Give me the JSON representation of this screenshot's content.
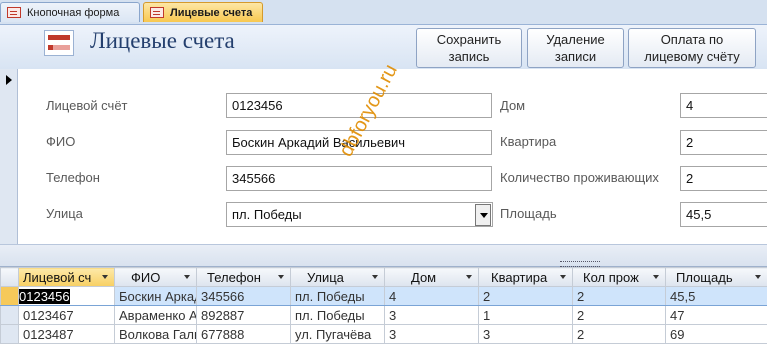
{
  "tabs": [
    {
      "label": "Кнопочная форма"
    },
    {
      "label": "Лицевые счета"
    }
  ],
  "form": {
    "title": "Лицевые счета",
    "buttons": {
      "save": "Сохранить\nзапись",
      "delete": "Удаление\nзаписи",
      "payment": "Оплата по\nлицевому счёту"
    }
  },
  "fields": {
    "account": {
      "label": "Лицевой счёт",
      "value": "0123456"
    },
    "fio": {
      "label": "ФИО",
      "value": "Боскин Аркадий Васильевич"
    },
    "phone": {
      "label": "Телефон",
      "value": "345566"
    },
    "street": {
      "label": "Улица",
      "value": "пл. Победы"
    },
    "house": {
      "label": "Дом",
      "value": "4"
    },
    "apartment": {
      "label": "Квартира",
      "value": "2"
    },
    "residents": {
      "label": "Количество проживающих",
      "value": "2"
    },
    "area": {
      "label": "Площадь",
      "value": "45,5"
    }
  },
  "watermark": "dbforyou.ru",
  "grid": {
    "columns": [
      "Лицевой сч",
      "ФИО",
      "Телефон",
      "Улица",
      "Дом",
      "Квартира",
      "Кол прож",
      "Площадь"
    ],
    "rows": [
      [
        "0123456",
        "Боскин Аркадий Васильевич",
        "345566",
        "пл. Победы",
        "4",
        "2",
        "2",
        "45,5"
      ],
      [
        "0123467",
        "Авраменко Анна",
        "892887",
        "пл. Победы",
        "3",
        "1",
        "2",
        "47"
      ],
      [
        "0123487",
        "Волкова Галина",
        "677888",
        "ул.  Пугачёва",
        "3",
        "3",
        "2",
        "69"
      ]
    ],
    "selected_row": 0
  },
  "colors": {
    "active_tab": "#f8c850",
    "title": "#243f6e",
    "selected_row": "#cfe4fb",
    "watermark": "#e08c00"
  }
}
